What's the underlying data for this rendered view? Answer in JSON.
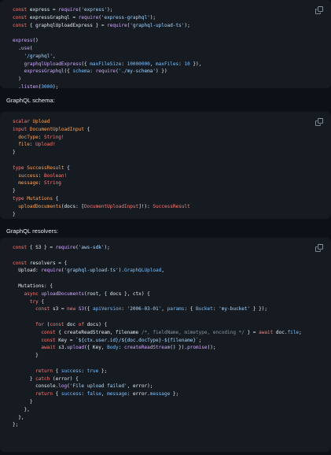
{
  "code_blocks": [
    {
      "lines": [
        [
          [
            "k",
            "const"
          ],
          [
            "p",
            " express = "
          ],
          [
            "f",
            "require"
          ],
          [
            "p",
            "("
          ],
          [
            "s",
            "'express'"
          ],
          [
            "p",
            ");"
          ]
        ],
        [
          [
            "k",
            "const"
          ],
          [
            "p",
            " expressGraphql = "
          ],
          [
            "f",
            "require"
          ],
          [
            "p",
            "("
          ],
          [
            "s",
            "'express-graphql'"
          ],
          [
            "p",
            ");"
          ]
        ],
        [
          [
            "k",
            "const"
          ],
          [
            "p",
            " { graphqlUploadExpress } = "
          ],
          [
            "f",
            "require"
          ],
          [
            "p",
            "("
          ],
          [
            "s",
            "'graphql-upload-ts'"
          ],
          [
            "p",
            ");"
          ]
        ],
        [],
        [
          [
            "f",
            "express"
          ],
          [
            "p",
            "()"
          ]
        ],
        [
          [
            "p",
            "  ."
          ],
          [
            "f",
            "use"
          ],
          [
            "p",
            "("
          ]
        ],
        [
          [
            "p",
            "    "
          ],
          [
            "s",
            "'/graphql'"
          ],
          [
            "p",
            ","
          ]
        ],
        [
          [
            "p",
            "    "
          ],
          [
            "f",
            "graphqlUploadExpress"
          ],
          [
            "p",
            "({ "
          ],
          [
            "n",
            "maxFileSize"
          ],
          [
            "p",
            ": "
          ],
          [
            "n",
            "10000000"
          ],
          [
            "p",
            ", "
          ],
          [
            "n",
            "maxFiles"
          ],
          [
            "p",
            ": "
          ],
          [
            "n",
            "10"
          ],
          [
            "p",
            " }),"
          ]
        ],
        [
          [
            "p",
            "    "
          ],
          [
            "f",
            "expressGraphql"
          ],
          [
            "p",
            "({ "
          ],
          [
            "n",
            "schema"
          ],
          [
            "p",
            ": "
          ],
          [
            "f",
            "require"
          ],
          [
            "p",
            "("
          ],
          [
            "s",
            "'./my-schema'"
          ],
          [
            "p",
            ") })"
          ]
        ],
        [
          [
            "p",
            "  )"
          ]
        ],
        [
          [
            "p",
            "  ."
          ],
          [
            "f",
            "listen"
          ],
          [
            "p",
            "("
          ],
          [
            "n",
            "3000"
          ],
          [
            "p",
            ");"
          ]
        ]
      ]
    },
    {
      "lines": [
        [
          [
            "k",
            "scalar"
          ],
          [
            "p",
            " "
          ],
          [
            "t",
            "Upload"
          ]
        ],
        [
          [
            "k",
            "input"
          ],
          [
            "p",
            " "
          ],
          [
            "t",
            "DocumentUploadInput"
          ],
          [
            "p",
            " {"
          ]
        ],
        [
          [
            "p",
            "  "
          ],
          [
            "t",
            "docType"
          ],
          [
            "p",
            ": "
          ],
          [
            "k",
            "String!"
          ]
        ],
        [
          [
            "p",
            "  "
          ],
          [
            "t",
            "file"
          ],
          [
            "p",
            ": "
          ],
          [
            "k",
            "Upload!"
          ]
        ],
        [
          [
            "p",
            "}"
          ]
        ],
        [],
        [
          [
            "k",
            "type"
          ],
          [
            "p",
            " "
          ],
          [
            "t",
            "SuccessResult"
          ],
          [
            "p",
            " {"
          ]
        ],
        [
          [
            "p",
            "  "
          ],
          [
            "t",
            "success"
          ],
          [
            "p",
            ": "
          ],
          [
            "k",
            "Boolean!"
          ]
        ],
        [
          [
            "p",
            "  "
          ],
          [
            "t",
            "message"
          ],
          [
            "p",
            ": "
          ],
          [
            "k",
            "String"
          ]
        ],
        [
          [
            "p",
            "}"
          ]
        ],
        [
          [
            "k",
            "type"
          ],
          [
            "p",
            " "
          ],
          [
            "t",
            "Mutations"
          ],
          [
            "p",
            " {"
          ]
        ],
        [
          [
            "p",
            "  "
          ],
          [
            "t",
            "uploadDocuments"
          ],
          [
            "p",
            "(docs: ["
          ],
          [
            "k",
            "DocumentUploadInput"
          ],
          [
            "p",
            "]!): "
          ],
          [
            "k",
            "SuccessResult"
          ]
        ],
        [
          [
            "p",
            "}"
          ]
        ]
      ]
    },
    {
      "lines": [
        [
          [
            "k",
            "const"
          ],
          [
            "p",
            " { S3 } = "
          ],
          [
            "f",
            "require"
          ],
          [
            "p",
            "("
          ],
          [
            "s",
            "'aws-sdk'"
          ],
          [
            "p",
            ");"
          ]
        ],
        [],
        [
          [
            "k",
            "const"
          ],
          [
            "p",
            " resolvers = {"
          ]
        ],
        [
          [
            "p",
            "  Upload: "
          ],
          [
            "f",
            "require"
          ],
          [
            "p",
            "("
          ],
          [
            "s",
            "'graphql-upload-ts'"
          ],
          [
            "p",
            ")."
          ],
          [
            "n",
            "GraphQLUpload"
          ],
          [
            "p",
            ","
          ]
        ],
        [],
        [
          [
            "p",
            "  Mutations: {"
          ]
        ],
        [
          [
            "p",
            "    "
          ],
          [
            "k",
            "async"
          ],
          [
            "p",
            " "
          ],
          [
            "f",
            "uploadDocuments"
          ],
          [
            "p",
            "(root, { docs }, ctx) {"
          ]
        ],
        [
          [
            "p",
            "      "
          ],
          [
            "k",
            "try"
          ],
          [
            "p",
            " {"
          ]
        ],
        [
          [
            "p",
            "        "
          ],
          [
            "k",
            "const"
          ],
          [
            "p",
            " s3 = "
          ],
          [
            "k",
            "new"
          ],
          [
            "p",
            " "
          ],
          [
            "f",
            "S3"
          ],
          [
            "p",
            "({ "
          ],
          [
            "n",
            "apiVersion"
          ],
          [
            "p",
            ": "
          ],
          [
            "s",
            "'2006-03-01'"
          ],
          [
            "p",
            ", "
          ],
          [
            "n",
            "params"
          ],
          [
            "p",
            ": { "
          ],
          [
            "n",
            "Bucket"
          ],
          [
            "p",
            ": "
          ],
          [
            "s",
            "'my-bucket'"
          ],
          [
            "p",
            " } });"
          ]
        ],
        [],
        [
          [
            "p",
            "        "
          ],
          [
            "k",
            "for"
          ],
          [
            "p",
            " ("
          ],
          [
            "k",
            "const"
          ],
          [
            "p",
            " doc "
          ],
          [
            "k",
            "of"
          ],
          [
            "p",
            " docs) {"
          ]
        ],
        [
          [
            "p",
            "          "
          ],
          [
            "k",
            "const"
          ],
          [
            "p",
            " { createReadStream, filename "
          ],
          [
            "c",
            "/*, fieldName, mimetype, encoding */"
          ],
          [
            "p",
            " } = "
          ],
          [
            "k",
            "await"
          ],
          [
            "p",
            " doc."
          ],
          [
            "n",
            "file"
          ],
          [
            "p",
            ";"
          ]
        ],
        [
          [
            "p",
            "          "
          ],
          [
            "k",
            "const"
          ],
          [
            "p",
            " Key = "
          ],
          [
            "s",
            "`${ctx.user.id}/${doc.docType}-${filename}`"
          ],
          [
            "p",
            ";"
          ]
        ],
        [
          [
            "p",
            "          "
          ],
          [
            "k",
            "await"
          ],
          [
            "p",
            " s3."
          ],
          [
            "f",
            "upload"
          ],
          [
            "p",
            "({ Key, "
          ],
          [
            "n",
            "Body"
          ],
          [
            "p",
            ": "
          ],
          [
            "f",
            "createReadStream"
          ],
          [
            "p",
            "() })."
          ],
          [
            "f",
            "promise"
          ],
          [
            "p",
            "();"
          ]
        ],
        [
          [
            "p",
            "        }"
          ]
        ],
        [],
        [
          [
            "p",
            "        "
          ],
          [
            "k",
            "return"
          ],
          [
            "p",
            " { "
          ],
          [
            "n",
            "success"
          ],
          [
            "p",
            ": "
          ],
          [
            "n",
            "true"
          ],
          [
            "p",
            " };"
          ]
        ],
        [
          [
            "p",
            "      } "
          ],
          [
            "k",
            "catch"
          ],
          [
            "p",
            " (error) {"
          ]
        ],
        [
          [
            "p",
            "        console."
          ],
          [
            "f",
            "log"
          ],
          [
            "p",
            "("
          ],
          [
            "s",
            "'File upload failed'"
          ],
          [
            "p",
            ", error);"
          ]
        ],
        [
          [
            "p",
            "        "
          ],
          [
            "k",
            "return"
          ],
          [
            "p",
            " { "
          ],
          [
            "n",
            "success"
          ],
          [
            "p",
            ": "
          ],
          [
            "n",
            "false"
          ],
          [
            "p",
            ", "
          ],
          [
            "n",
            "message"
          ],
          [
            "p",
            ": error."
          ],
          [
            "n",
            "message"
          ],
          [
            "p",
            " };"
          ]
        ],
        [
          [
            "p",
            "      }"
          ]
        ],
        [
          [
            "p",
            "    },"
          ]
        ],
        [
          [
            "p",
            "  },"
          ]
        ],
        [
          [
            "p",
            "};"
          ]
        ]
      ]
    }
  ],
  "headings": {
    "schema": "GraphQL schema:",
    "resolvers": "GraphQL resolvers:"
  },
  "icons": {
    "copy": "copy-icon"
  },
  "colors": {
    "background": "#0d1117",
    "code_background": "#161b22",
    "keyword": "#ff7b72",
    "string": "#a5d6ff",
    "function": "#d2a8ff",
    "comment": "#8b949e",
    "constant": "#79c0ff"
  }
}
